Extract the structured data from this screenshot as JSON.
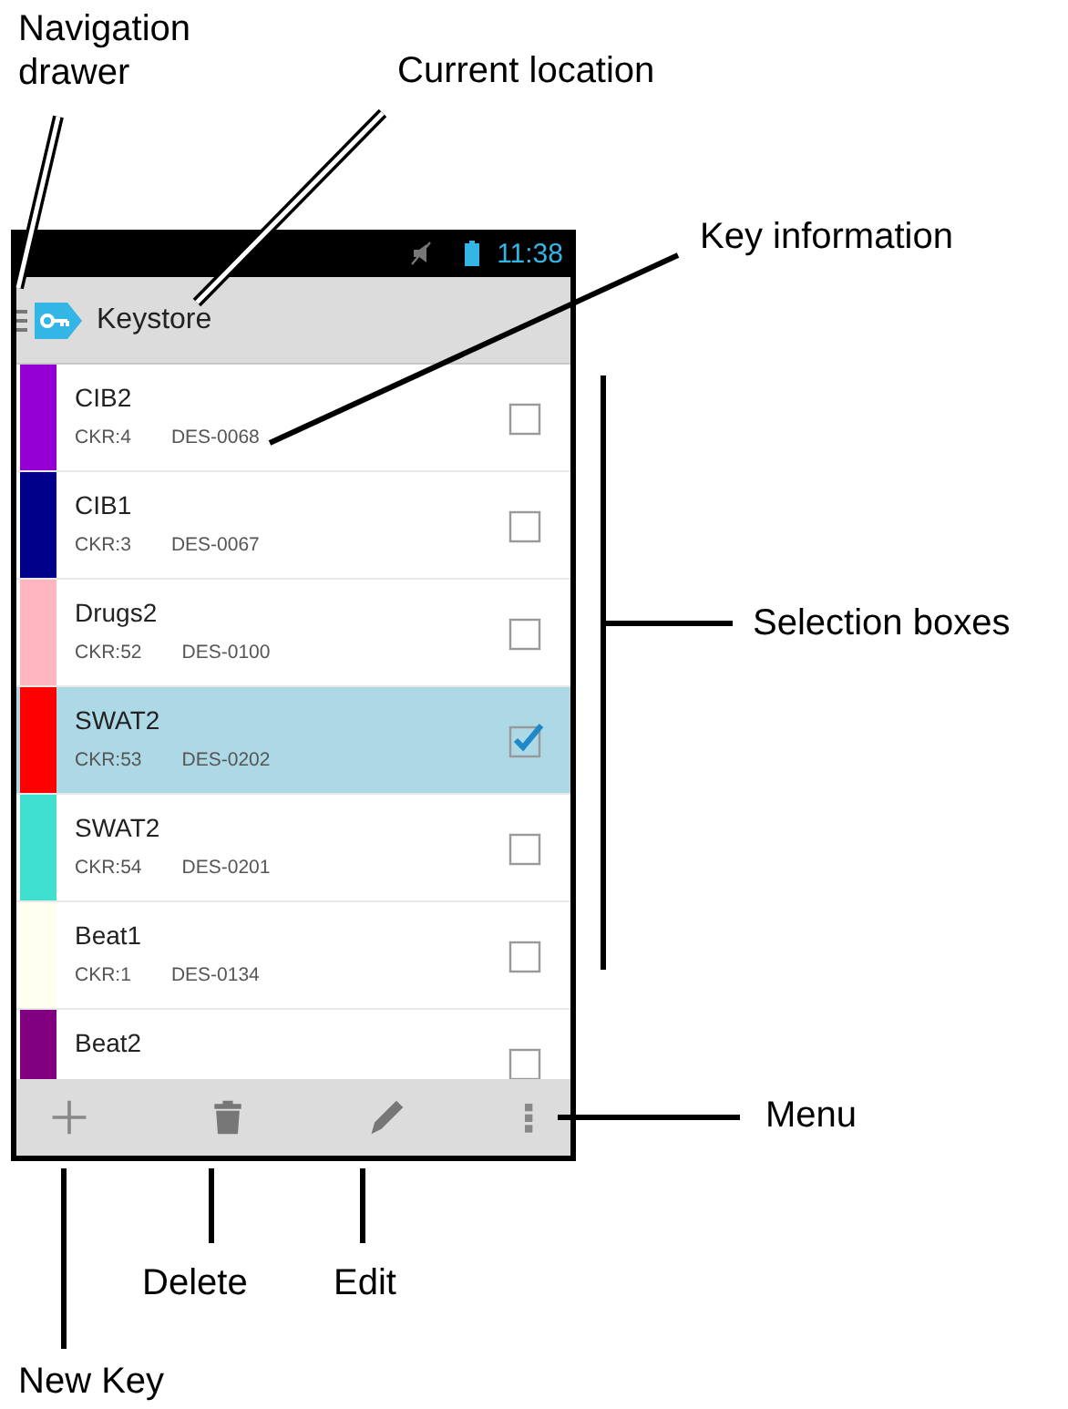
{
  "status_bar": {
    "time": "11:38"
  },
  "action_bar": {
    "title": "Keystore"
  },
  "keys": [
    {
      "name": "CIB2",
      "ckr": "CKR:4",
      "des": "DES-0068",
      "color": "#9400d3",
      "selected": false
    },
    {
      "name": "CIB1",
      "ckr": "CKR:3",
      "des": "DES-0067",
      "color": "#00008b",
      "selected": false
    },
    {
      "name": "Drugs2",
      "ckr": "CKR:52",
      "des": "DES-0100",
      "color": "#ffb6c1",
      "selected": false
    },
    {
      "name": "SWAT2",
      "ckr": "CKR:53",
      "des": "DES-0202",
      "color": "#ff0000",
      "selected": true
    },
    {
      "name": "SWAT2",
      "ckr": "CKR:54",
      "des": "DES-0201",
      "color": "#40e0d0",
      "selected": false
    },
    {
      "name": "Beat1",
      "ckr": "CKR:1",
      "des": "DES-0134",
      "color": "#fffff0",
      "selected": false
    },
    {
      "name": "Beat2",
      "color": "#800080",
      "selected": false
    }
  ],
  "annotations": [
    {
      "kind": "nav",
      "text": "Navigation drawer"
    },
    {
      "kind": "location",
      "text": "Current location"
    },
    {
      "kind": "info",
      "text": "Key information"
    },
    {
      "kind": "selection",
      "text": "Selection boxes"
    },
    {
      "kind": "menu",
      "text": "Menu"
    },
    {
      "kind": "delete",
      "text": "Delete"
    },
    {
      "kind": "edit",
      "text": "Edit"
    },
    {
      "kind": "new",
      "text": "New Key"
    }
  ]
}
